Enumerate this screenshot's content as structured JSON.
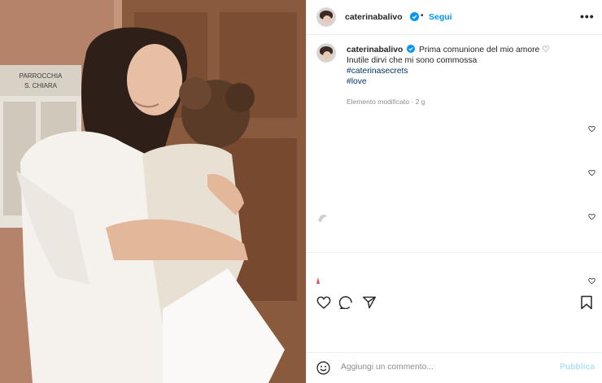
{
  "post": {
    "username": "caterinabalivo",
    "follow_label": "Segui",
    "header_separator": "•",
    "more_label": "•••",
    "caption": {
      "username": "caterinabalivo",
      "line1": "Prima comunione del mio amore ♡",
      "line2": "Inutile dirvi che mi sono commossa",
      "hashtag1": "#caterinasecrets",
      "hashtag2": "#love"
    },
    "meta": "Elemento modificato · 2 g",
    "photo_sign": {
      "line1": "PARROCCHIA",
      "line2": "S. CHIARA"
    },
    "comment_placeholder": "Aggiungi un commento...",
    "publish_label": "Pubblica"
  },
  "colors": {
    "accent": "#0095f6",
    "hashtag": "#00376b",
    "muted": "#8e8e8e",
    "publish_disabled": "#b2dffc"
  },
  "icons": {
    "verified": "verified-badge-icon",
    "more": "more-options-icon",
    "like": "heart-icon",
    "comment": "comment-icon",
    "share": "share-icon",
    "save": "bookmark-icon",
    "emoji": "emoji-icon"
  }
}
